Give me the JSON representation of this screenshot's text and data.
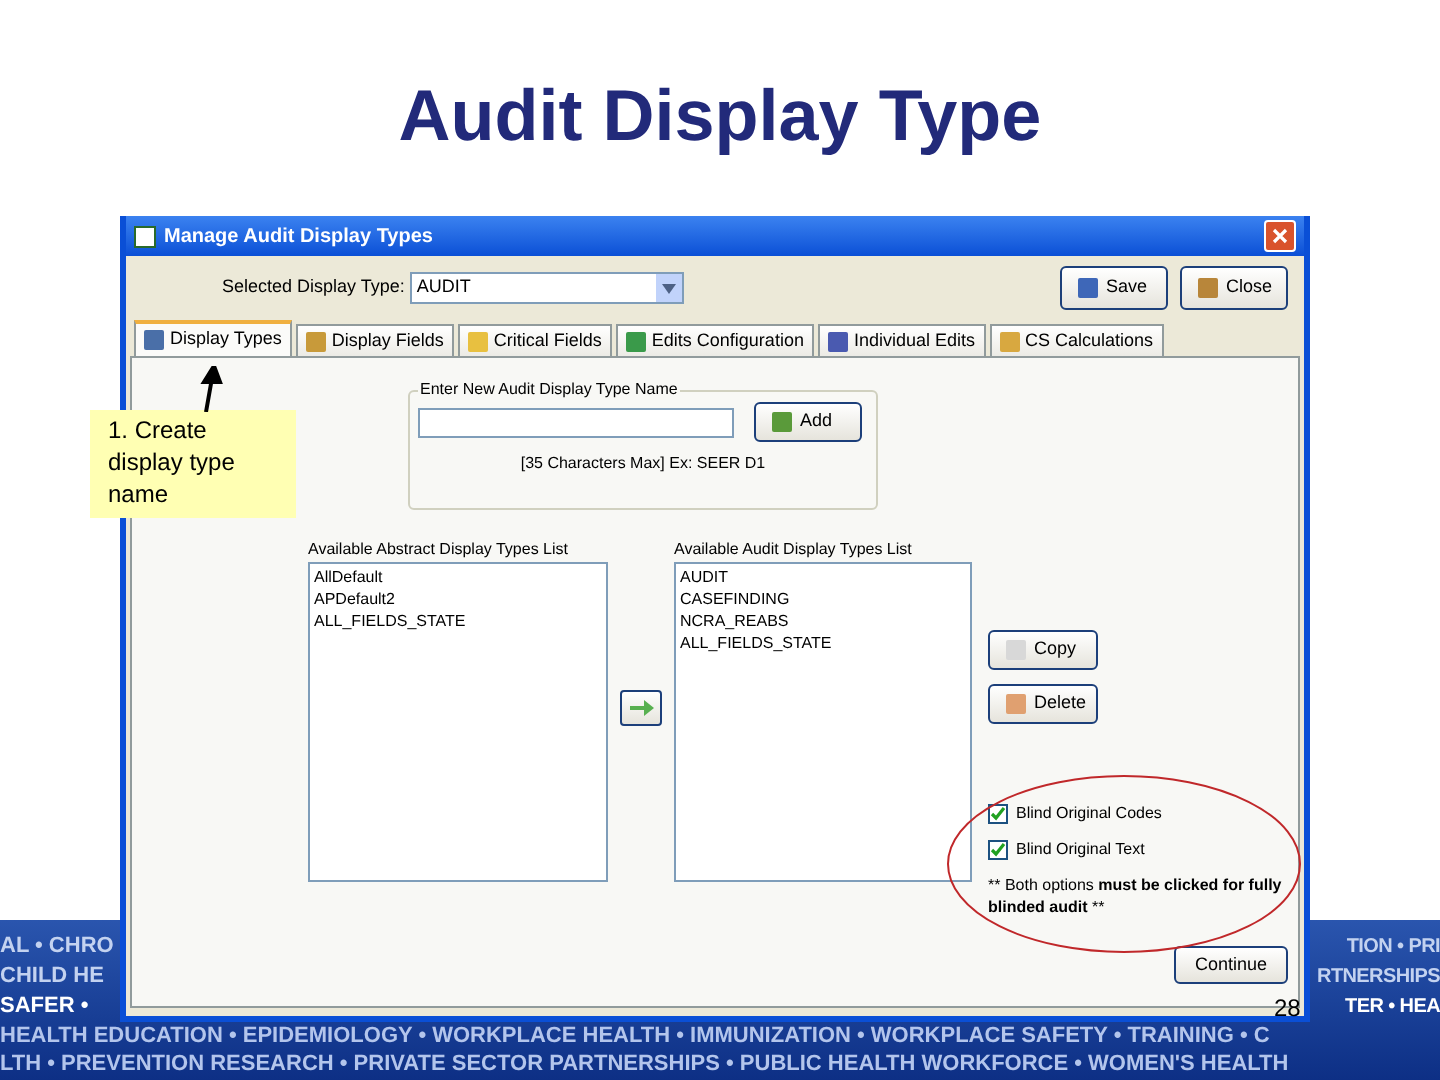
{
  "slide_title": "Audit Display Type",
  "window": {
    "title": "Manage Audit Display Types"
  },
  "toolbar": {
    "label": "Selected Display Type:",
    "value": "AUDIT",
    "buttons": [
      "Save",
      "Close"
    ]
  },
  "tabs": [
    {
      "label": "Display Types",
      "selected": true
    },
    {
      "label": "Display Fields",
      "selected": false
    },
    {
      "label": "Critical Fields",
      "selected": false
    },
    {
      "label": "Edits Configuration",
      "selected": false
    },
    {
      "label": "Individual Edits",
      "selected": false
    },
    {
      "label": "CS Calculations",
      "selected": false
    }
  ],
  "new_name": {
    "legend": "Enter New Audit Display Type Name",
    "button": "Add",
    "hint": "[35 Characters Max] Ex: SEER D1"
  },
  "abstract_list": {
    "label": "Available Abstract Display Types List",
    "items": [
      "AllDefault",
      "APDefault2",
      "ALL_FIELDS_STATE"
    ]
  },
  "audit_list": {
    "label": "Available Audit Display Types List",
    "items": [
      "AUDIT",
      "CASEFINDING",
      "NCRA_REABS",
      "ALL_FIELDS_STATE"
    ]
  },
  "side_buttons": [
    "Copy",
    "Delete"
  ],
  "options": [
    {
      "label": "Blind Original Codes",
      "checked": true
    },
    {
      "label": "Blind Original Text",
      "checked": true
    }
  ],
  "note": "** Both options **must be clicked for fully blinded audit** **",
  "continue_button": "Continue",
  "callout": "1. Create display type name",
  "banner": {
    "left": [
      "AL • CHRO",
      "CHILD HE",
      "SAFER •"
    ],
    "right": [
      "TION • PRI",
      "RTNERSHIPS",
      "TER • HEA"
    ],
    "rows": [
      "HEALTH EDUCATION • EPIDEMIOLOGY • WORKPLACE HEALTH • IMMUNIZATION • WORKPLACE SAFETY • TRAINING • C",
      "LTH • PREVENTION RESEARCH • PRIVATE SECTOR PARTNERSHIPS • PUBLIC HEALTH WORKFORCE • WOMEN'S HEALTH"
    ]
  },
  "page_number": "28"
}
